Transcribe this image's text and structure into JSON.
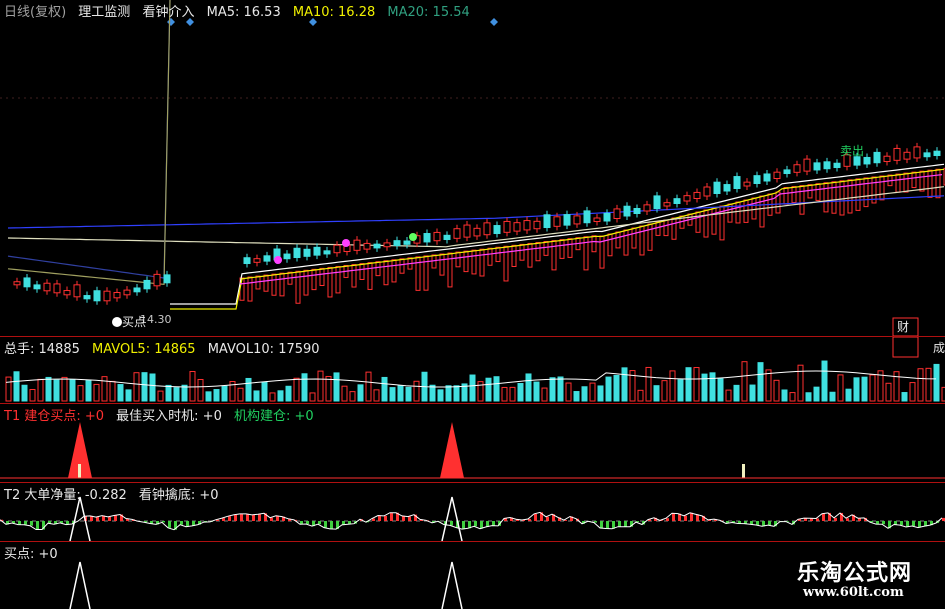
{
  "main": {
    "period": "日线(复权)",
    "indicator1": "理工监测",
    "indicator2": "看钟介入",
    "ma5": "MA5: 16.53",
    "ma10": "MA10: 16.28",
    "ma20": "MA20: 15.54",
    "buy_label": "买点",
    "price_label": "14.30",
    "sell_label": "卖出",
    "side_label": "财"
  },
  "volume": {
    "total": "总手: 14885",
    "mavol5": "MAVOL5: 14865",
    "mavol10": "MAVOL10: 17590",
    "side_label": "成"
  },
  "t1": {
    "a": "T1 建仓买点: +0",
    "b": "最佳买入时机: +0",
    "c": "机构建仓: +0"
  },
  "t2": {
    "a": "T2 大单净量: -0.282",
    "b": "看钟擒底: +0"
  },
  "t3": {
    "a": "买点: +0"
  },
  "watermark": {
    "title": "乐淘公式网",
    "url": "www.60lt.com"
  },
  "colors": {
    "up": "#ff3030",
    "down": "#40e0e0",
    "ma5": "#ffffff",
    "ma10": "#f0f000",
    "ma20": "#ff40ff",
    "line_blue": "#3040ff"
  }
}
